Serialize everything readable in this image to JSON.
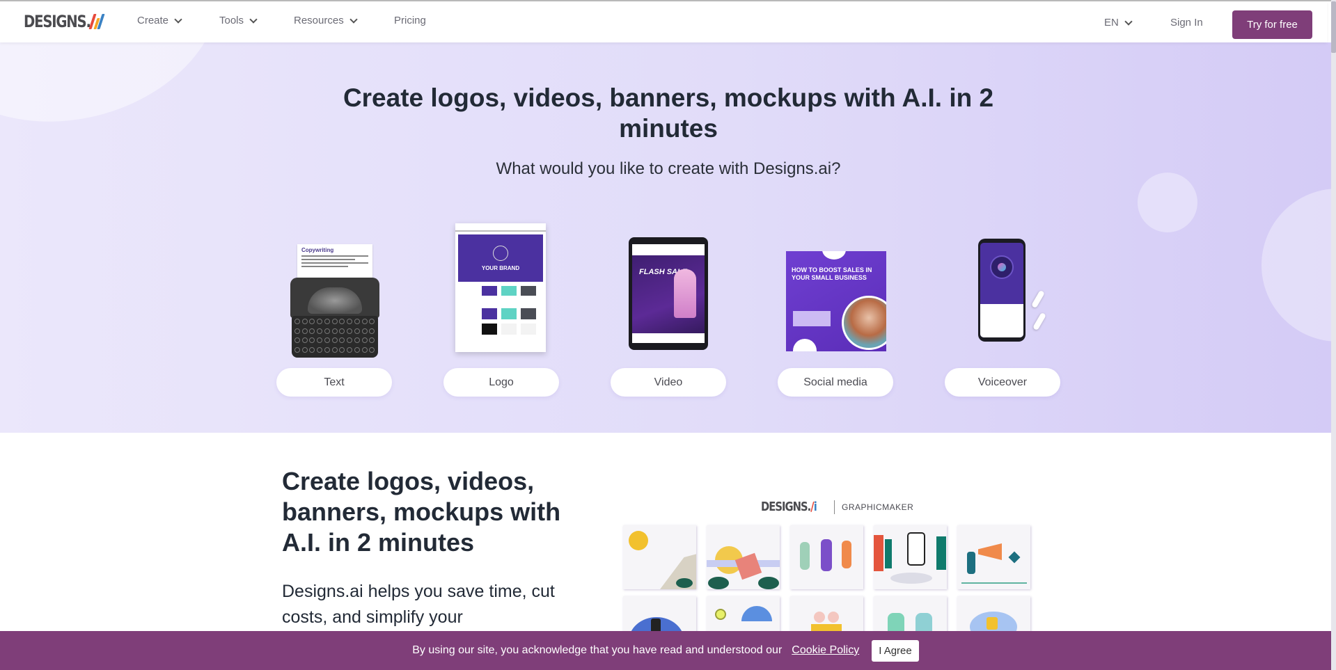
{
  "nav": {
    "logo": "DESIGNS.",
    "logo_ai_colors": [
      "#e64a3c",
      "#f5a623",
      "#3b82c4",
      "#7b4fc9"
    ],
    "items": [
      {
        "label": "Create",
        "dropdown": true
      },
      {
        "label": "Tools",
        "dropdown": true
      },
      {
        "label": "Resources",
        "dropdown": true
      },
      {
        "label": "Pricing",
        "dropdown": false
      }
    ],
    "language": "EN",
    "sign_in": "Sign In",
    "cta": "Try for free",
    "cta_color": "#7f3e79"
  },
  "hero": {
    "title": "Create logos, videos, banners, mockups with A.I. in 2 minutes",
    "subtitle": "What would you like to create with Designs.ai?",
    "cards": [
      {
        "label": "Text",
        "image": "typewriter-copywriting",
        "image_caption": "Copywriting"
      },
      {
        "label": "Logo",
        "image": "brand-guideline-doc",
        "image_caption": "YOUR BRAND"
      },
      {
        "label": "Video",
        "image": "tablet-flash-sale",
        "image_caption": "FLASH SALE"
      },
      {
        "label": "Social media",
        "image": "social-post",
        "image_caption": "HOW TO BOOST SALES IN YOUR SMALL BUSINESS"
      },
      {
        "label": "Voiceover",
        "image": "phone-recorder",
        "image_caption": ""
      }
    ]
  },
  "feature": {
    "title": "Create logos, videos, banners, mockups with A.I. in 2 minutes",
    "description": "Designs.ai helps you save time, cut costs, and simplify your",
    "graphicmaker": {
      "logo": "DESIGNS.",
      "label": "GRAPHICMAKER",
      "tiles": [
        "mountain-climbers",
        "beach-lounger",
        "dancing-people",
        "phone-interaction",
        "megaphone-marketing",
        "remote-work",
        "beach-umbrella",
        "elderly-couple",
        "business-handshake",
        "cloud-security"
      ]
    }
  },
  "cookie": {
    "text": "By using our site, you acknowledge that you have read and understood our",
    "link": "Cookie Policy",
    "button": "I Agree",
    "bg_color": "#7f3e79"
  }
}
